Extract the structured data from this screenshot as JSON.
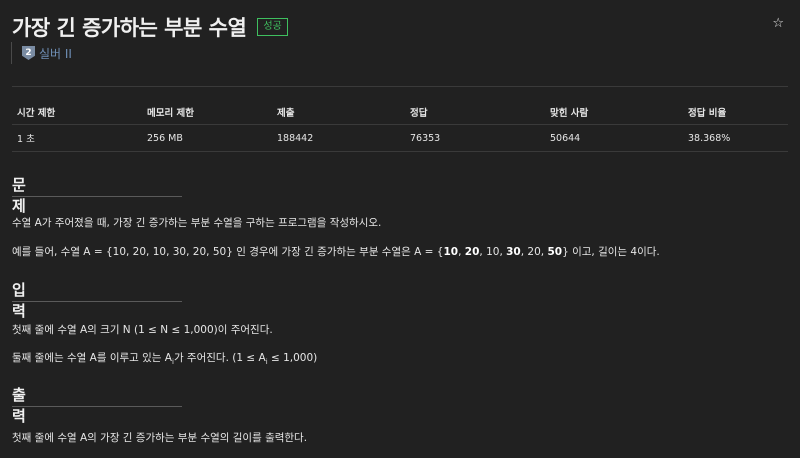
{
  "problem": {
    "title": "가장 긴 증가하는 부분 수열",
    "status_badge": "성공",
    "tier_label": "실버 II",
    "tier_icon_text": "2"
  },
  "info_table": {
    "headers": [
      "시간 제한",
      "메모리 제한",
      "제출",
      "정답",
      "맞힌 사람",
      "정답 비율"
    ],
    "values": [
      "1 초",
      "256 MB",
      "188442",
      "76353",
      "50644",
      "38.368%"
    ]
  },
  "sections": {
    "problem": {
      "title": "문제",
      "line1": "수열 A가 주어졌을 때, 가장 긴 증가하는 부분 수열을 구하는 프로그램을 작성하시오.",
      "line2_a": "예를 들어, 수열 A = {10, 20, 10, 30, 20, 50} 인 경우에 가장 긴 증가하는 부분 수열은 A = {",
      "b1": "10",
      "c1": ", ",
      "b2": "20",
      "c2": ", 10, ",
      "b3": "30",
      "c3": ", 20, ",
      "b4": "50",
      "line2_z": "} 이고, 길이는 4이다."
    },
    "input": {
      "title": "입력",
      "line1": "첫째 줄에 수열 A의 크기 N (1 ≤ N ≤ 1,000)이 주어진다.",
      "line2_a": "둘째 줄에는 수열 A를 이루고 있는 A",
      "line2_sub": "i",
      "line2_b": "가 주어진다. (1 ≤ A",
      "line2_sub2": "i",
      "line2_c": " ≤ 1,000)"
    },
    "output": {
      "title": "출력",
      "line1": "첫째 줄에 수열 A의 가장 긴 증가하는 부분 수열의 길이를 출력한다."
    }
  }
}
